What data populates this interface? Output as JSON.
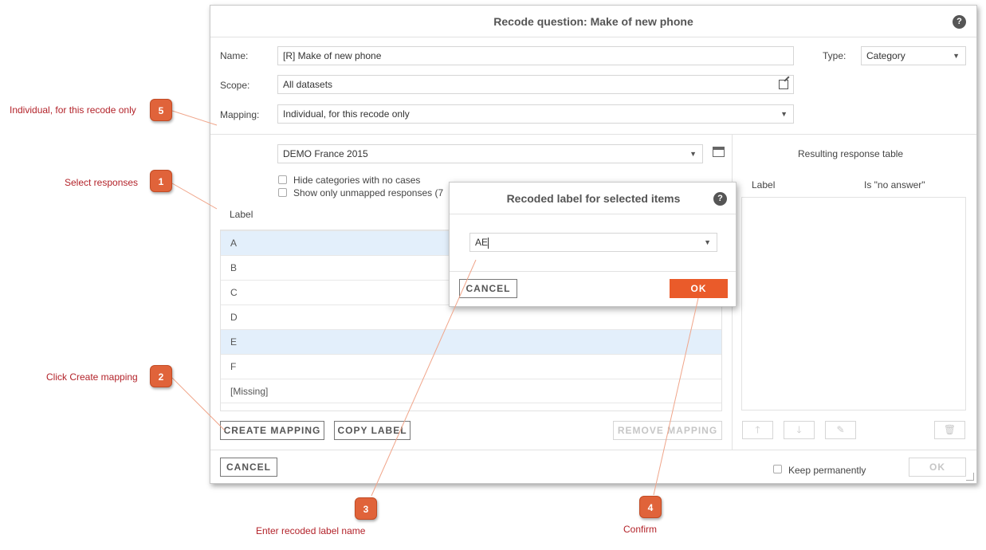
{
  "dialog": {
    "title": "Recode question: Make of new phone",
    "help": "?",
    "name_label": "Name:",
    "name_value": "[R] Make of new phone",
    "type_label": "Type:",
    "type_value": "Category",
    "scope_label": "Scope:",
    "scope_value": "All datasets",
    "mapping_label": "Mapping:",
    "mapping_value": "Individual, for this recode only"
  },
  "left_panel": {
    "dataset_value": "DEMO France 2015",
    "hide_categories_label": "Hide categories with no cases",
    "show_unmapped_label": "Show only unmapped responses (7",
    "column_label": "Label",
    "rows": [
      {
        "label": "A",
        "selected": true
      },
      {
        "label": "B",
        "selected": false
      },
      {
        "label": "C",
        "selected": false
      },
      {
        "label": "D",
        "selected": false
      },
      {
        "label": "E",
        "selected": true
      },
      {
        "label": "F",
        "selected": false
      },
      {
        "label": "[Missing]",
        "selected": false
      }
    ],
    "create_mapping": "CREATE MAPPING",
    "copy_label": "COPY LABEL",
    "remove_mapping": "REMOVE MAPPING"
  },
  "right_panel": {
    "title": "Resulting response table",
    "col_label": "Label",
    "col_no_answer": "Is \"no answer\""
  },
  "footer": {
    "cancel": "CANCEL",
    "keep_permanently": "Keep permanently",
    "ok": "OK"
  },
  "popup": {
    "title": "Recoded label for selected items",
    "help": "?",
    "input_value": "AE",
    "cancel": "CANCEL",
    "ok": "OK"
  },
  "callouts": [
    {
      "number": "1",
      "text": "Select responses"
    },
    {
      "number": "2",
      "text": "Click Create mapping"
    },
    {
      "number": "3",
      "text": "Enter recoded label name"
    },
    {
      "number": "4",
      "text": "Confirm"
    },
    {
      "number": "5",
      "text": "Individual, for this recode only"
    }
  ],
  "colors": {
    "accent": "#ea5b2a",
    "selection": "#e3effb",
    "callout_text": "#b3232a"
  }
}
